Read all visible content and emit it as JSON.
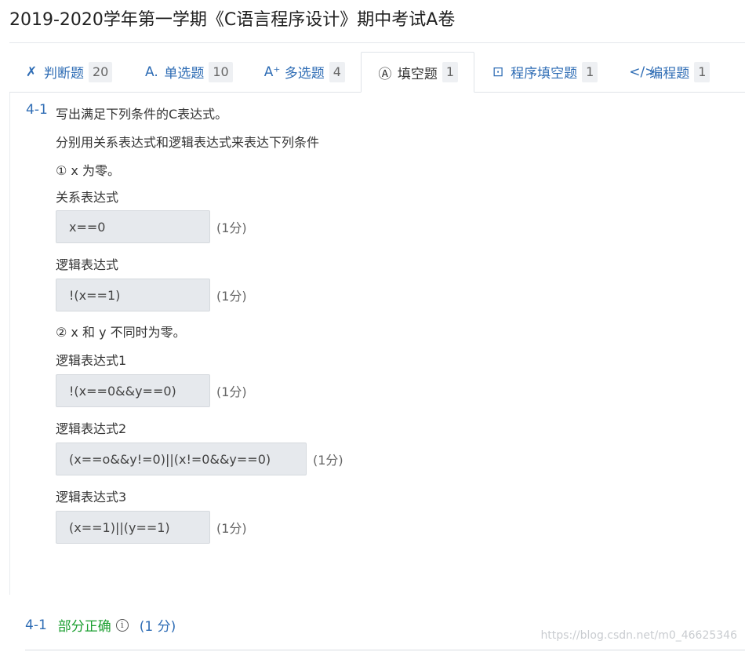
{
  "page": {
    "title": "2019-2020学年第一学期《C语言程序设计》期中考试A卷"
  },
  "tabs": [
    {
      "icon": "true-false-icon",
      "glyph": "✗",
      "label": "判断题",
      "count": "20"
    },
    {
      "icon": "single-choice-icon",
      "glyph": "A.",
      "label": "单选题",
      "count": "10"
    },
    {
      "icon": "multiple-choice-icon",
      "glyph": "A⁺",
      "label": "多选题",
      "count": "4"
    },
    {
      "icon": "fill-blank-icon",
      "glyph": "Ⓐ",
      "label": "填空题",
      "count": "1"
    },
    {
      "icon": "program-fill-icon",
      "glyph": "⊡",
      "label": "程序填空题",
      "count": "1"
    },
    {
      "icon": "code-icon",
      "glyph": "</>",
      "label": "编程题",
      "count": "1"
    }
  ],
  "question": {
    "number": "4-1",
    "title": "写出满足下列条件的C表达式。",
    "intro": "分别用关系表达式和逻辑表达式来表达下列条件",
    "cond1": "① x 为零。",
    "label_rel": "关系表达式",
    "ans1": "x==0",
    "label_logic": "逻辑表达式",
    "ans2": "!(x==1)",
    "cond2": "② x 和 y 不同时为零。",
    "label_logic1": "逻辑表达式1",
    "ans3": "!(x==0&&y==0)",
    "label_logic2": "逻辑表达式2",
    "ans4": "(x==o&&y!=0)||(x!=0&&y==0)",
    "label_logic3": "逻辑表达式3",
    "ans5": "(x==1)||(y==1)",
    "score": "(1分)"
  },
  "result": {
    "number": "4-1",
    "status": "部分正确",
    "info_glyph": "i",
    "score": "(1 分)"
  },
  "watermark": "https://blog.csdn.net/m0_46625346"
}
